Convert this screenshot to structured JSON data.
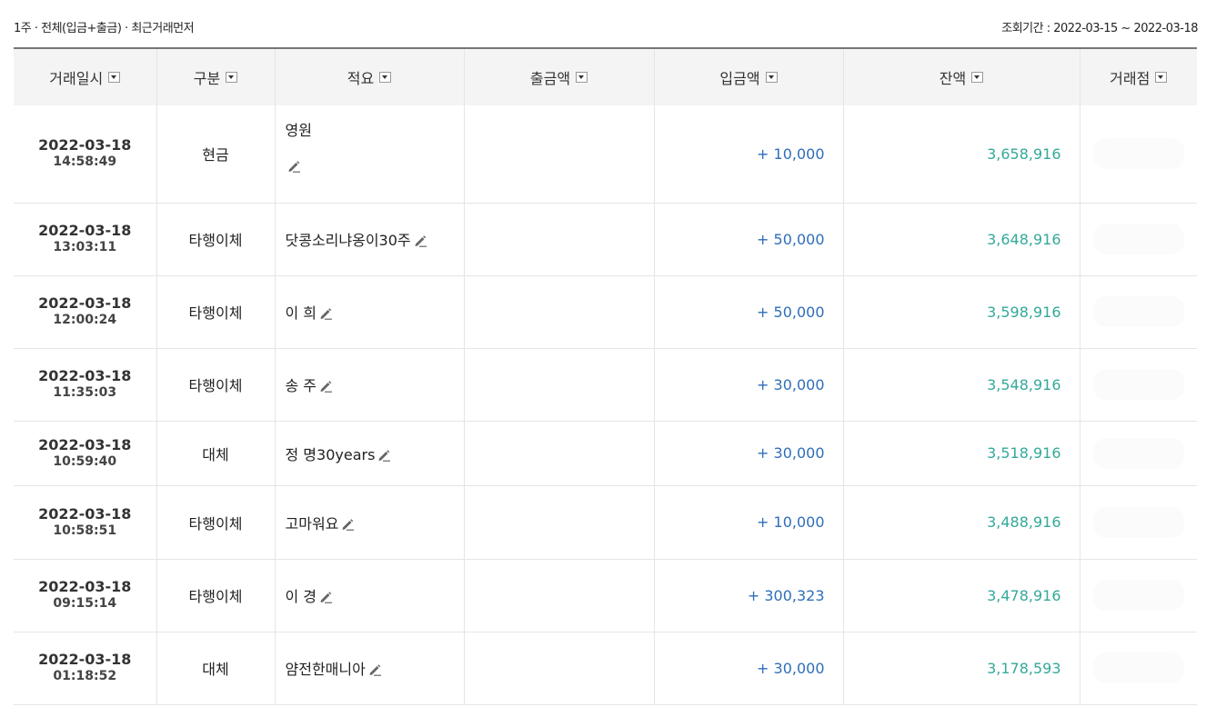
{
  "header": {
    "filter_text": "1주 · 전체(입금+출금) · 최근거래먼저",
    "period_text": "조회기간 : 2022-03-15 ~ 2022-03-18"
  },
  "columns": [
    {
      "label": "거래일시"
    },
    {
      "label": "구분"
    },
    {
      "label": "적요"
    },
    {
      "label": "출금액"
    },
    {
      "label": "입금액"
    },
    {
      "label": "잔액"
    },
    {
      "label": "거래점"
    }
  ],
  "rows": [
    {
      "date": "2022-03-18",
      "time": "14:58:49",
      "type": "현금",
      "memo": "영원",
      "withdraw": "",
      "deposit": "+ 10,000",
      "balance": "3,658,916",
      "branch": ""
    },
    {
      "date": "2022-03-18",
      "time": "13:03:11",
      "type": "타행이체",
      "memo": "닷콩소리냐옹이30주",
      "withdraw": "",
      "deposit": "+ 50,000",
      "balance": "3,648,916",
      "branch": ""
    },
    {
      "date": "2022-03-18",
      "time": "12:00:24",
      "type": "타행이체",
      "memo": "이  희",
      "withdraw": "",
      "deposit": "+ 50,000",
      "balance": "3,598,916",
      "branch": ""
    },
    {
      "date": "2022-03-18",
      "time": "11:35:03",
      "type": "타행이체",
      "memo": "송  주",
      "withdraw": "",
      "deposit": "+ 30,000",
      "balance": "3,548,916",
      "branch": ""
    },
    {
      "date": "2022-03-18",
      "time": "10:59:40",
      "type": "대체",
      "memo": "정  명30years",
      "withdraw": "",
      "deposit": "+ 30,000",
      "balance": "3,518,916",
      "branch": ""
    },
    {
      "date": "2022-03-18",
      "time": "10:58:51",
      "type": "타행이체",
      "memo": "고마워요",
      "withdraw": "",
      "deposit": "+ 10,000",
      "balance": "3,488,916",
      "branch": ""
    },
    {
      "date": "2022-03-18",
      "time": "09:15:14",
      "type": "타행이체",
      "memo": "이  경",
      "withdraw": "",
      "deposit": "+ 300,323",
      "balance": "3,478,916",
      "branch": ""
    },
    {
      "date": "2022-03-18",
      "time": "01:18:52",
      "type": "대체",
      "memo": "얌전한매니아",
      "withdraw": "",
      "deposit": "+ 30,000",
      "balance": "3,178,593",
      "branch": ""
    }
  ],
  "colors": {
    "deposit": "#2e6eb8",
    "balance": "#33a99a"
  },
  "icons": {
    "sort": "dropdown-icon",
    "edit": "pencil-icon"
  }
}
